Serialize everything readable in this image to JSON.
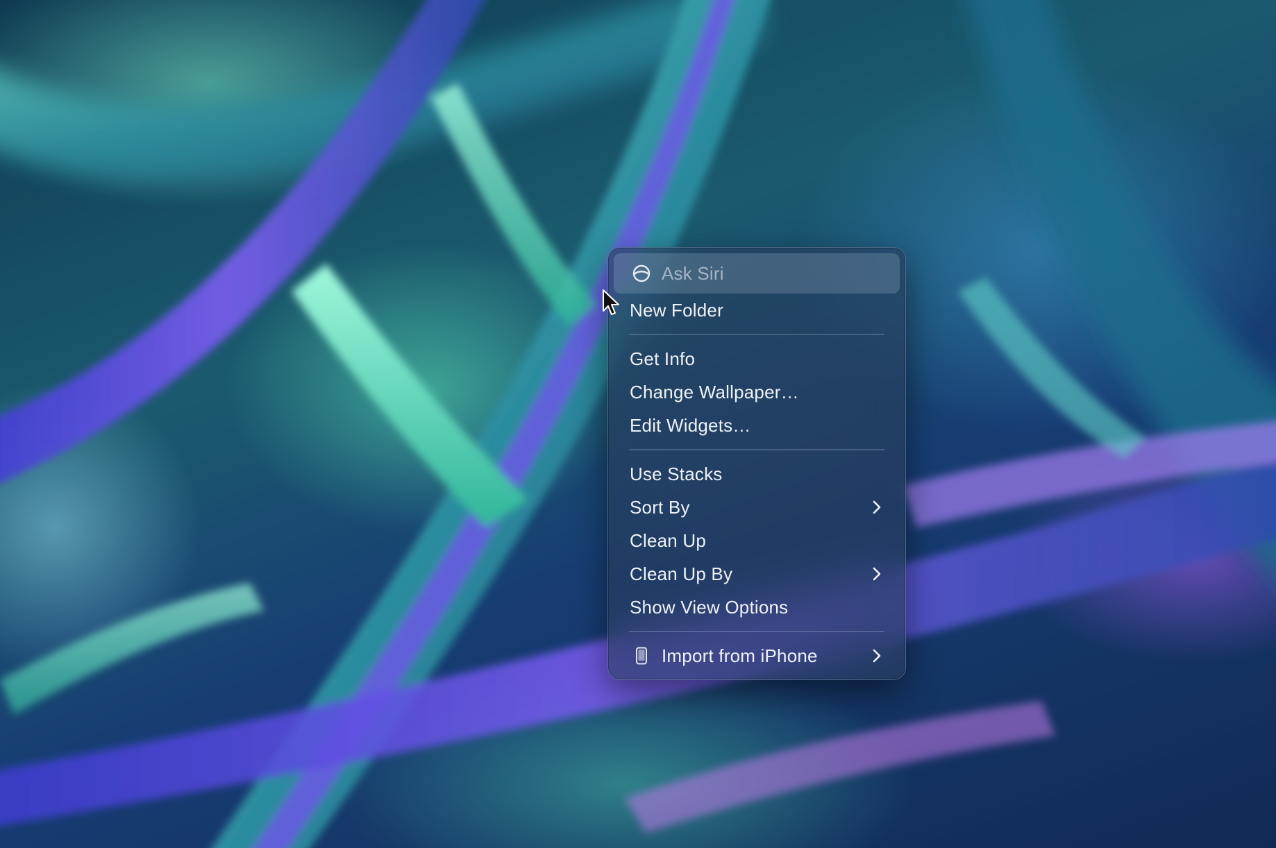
{
  "menu": {
    "items": [
      {
        "label": "Ask Siri",
        "icon": "siri-icon",
        "state": "disabled-highlighted"
      },
      {
        "label": "New Folder"
      },
      {
        "label": "Get Info"
      },
      {
        "label": "Change Wallpaper…"
      },
      {
        "label": "Edit Widgets…"
      },
      {
        "label": "Use Stacks"
      },
      {
        "label": "Sort By",
        "submenu": true
      },
      {
        "label": "Clean Up"
      },
      {
        "label": "Clean Up By",
        "submenu": true
      },
      {
        "label": "Show View Options"
      },
      {
        "label": "Import from iPhone",
        "icon": "iphone-icon",
        "submenu": true
      }
    ]
  },
  "colors": {
    "menu_background": "#283e5c",
    "menu_text": "#eef2f7",
    "wallpaper_teal": "#1b5a6e",
    "wallpaper_green": "#5ae6b4",
    "wallpaper_purple": "#965ae6"
  }
}
